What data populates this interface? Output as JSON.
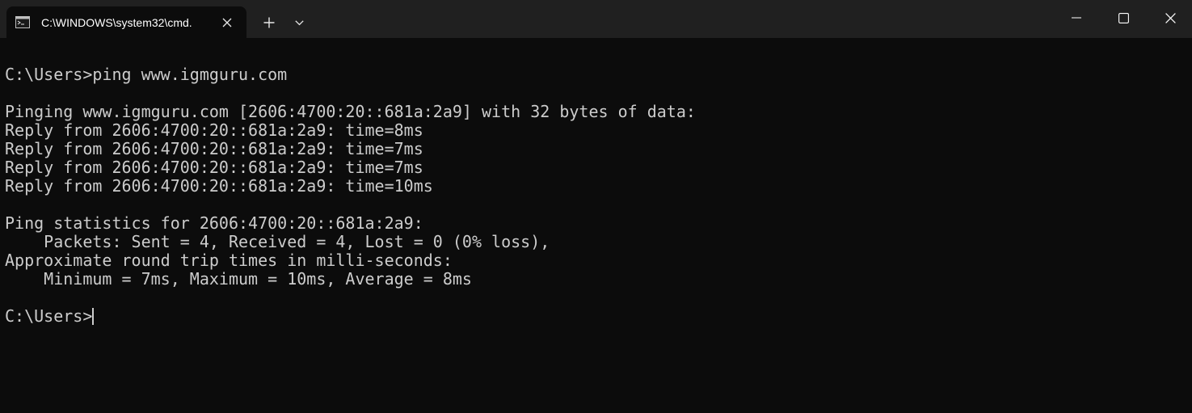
{
  "window": {
    "tab_title": "C:\\WINDOWS\\system32\\cmd.",
    "tab_icon": "terminal-app-icon",
    "close_tab_icon": "close-icon",
    "new_tab_icon": "plus-icon",
    "dropdown_icon": "chevron-down-icon",
    "minimize_icon": "minimize-icon",
    "maximize_icon": "maximize-icon",
    "close_window_icon": "close-icon"
  },
  "colors": {
    "titlebar_bg": "#202020",
    "terminal_bg": "#0c0c0c",
    "text": "#cccccc",
    "tab_text": "#ffffff"
  },
  "terminal": {
    "lines": [
      "C:\\Users>ping www.igmguru.com",
      "",
      "Pinging www.igmguru.com [2606:4700:20::681a:2a9] with 32 bytes of data:",
      "Reply from 2606:4700:20::681a:2a9: time=8ms",
      "Reply from 2606:4700:20::681a:2a9: time=7ms",
      "Reply from 2606:4700:20::681a:2a9: time=7ms",
      "Reply from 2606:4700:20::681a:2a9: time=10ms",
      "",
      "Ping statistics for 2606:4700:20::681a:2a9:",
      "    Packets: Sent = 4, Received = 4, Lost = 0 (0% loss),",
      "Approximate round trip times in milli-seconds:",
      "    Minimum = 7ms, Maximum = 10ms, Average = 8ms",
      ""
    ],
    "prompt": "C:\\Users>"
  }
}
